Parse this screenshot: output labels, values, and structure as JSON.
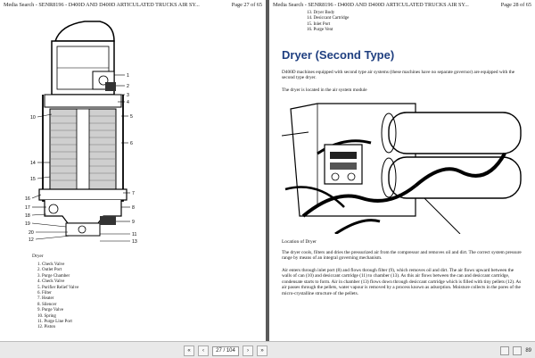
{
  "left_page": {
    "header_title": "Media Search - SENR8196 - D400D AND D400D ARTICULATED TRUCKS AIR SY...",
    "header_page": "Page 27 of 65",
    "figure_caption": "Dryer",
    "callouts": [
      "1",
      "2",
      "3",
      "4",
      "5",
      "6",
      "7",
      "8",
      "9",
      "10",
      "11",
      "12",
      "13",
      "14",
      "15",
      "16",
      "17",
      "18",
      "19",
      "20"
    ],
    "legend": [
      "1. Check Valve",
      "2. Outlet Port",
      "3. Purge Chamber",
      "4. Check Valve",
      "5. Purifier Relief Valve",
      "6. Filter",
      "7. Heater",
      "8. Silencer",
      "9. Purge Valve",
      "10. Spring",
      "11. Purge Line Port",
      "12. Piston"
    ]
  },
  "right_page": {
    "header_title": "Media Search - SENR8196 - D400D AND D400D ARTICULATED TRUCKS AIR SY...",
    "header_page": "Page 28 of 65",
    "legend_cont": [
      "13. Dryer Body",
      "14. Desiccant Cartridge",
      "15. Inlet Port",
      "16. Purge Vent"
    ],
    "heading": "Dryer (Second Type)",
    "intro": "D400D machines equipped with second type air systems (these machines have no separate governor) are equipped with the second type dryer.",
    "location_text": "The dryer is located in the air system module",
    "photo_caption": "Location of Dryer",
    "para1": "The dryer cools, filters and dries the pressurized air from the compressor and removes oil and dirt. The correct system pressure range by means of an integral governing mechanism.",
    "para2": "Air enters through inlet port (8) and flows through filter (9), which removes oil and dirt. The air flows upward between the walls of can (10) and desiccant cartridge (11) to chamber (13). As this air flows between the can and desiccant cartridge, condensate starts to form. Air in chamber (13) flows down through desiccant cartridge which is filled with tiny pellets (12). As air passes through the pellets, water vapour is removed by a process known as adsorption. Moisture collects in the pores of the micro-crystalline structure of the pellets."
  },
  "status_bar": {
    "prev_label": "‹",
    "next_label": "›",
    "first_label": "«",
    "last_label": "»",
    "page_input": "27 / 104",
    "zoom": "89"
  }
}
